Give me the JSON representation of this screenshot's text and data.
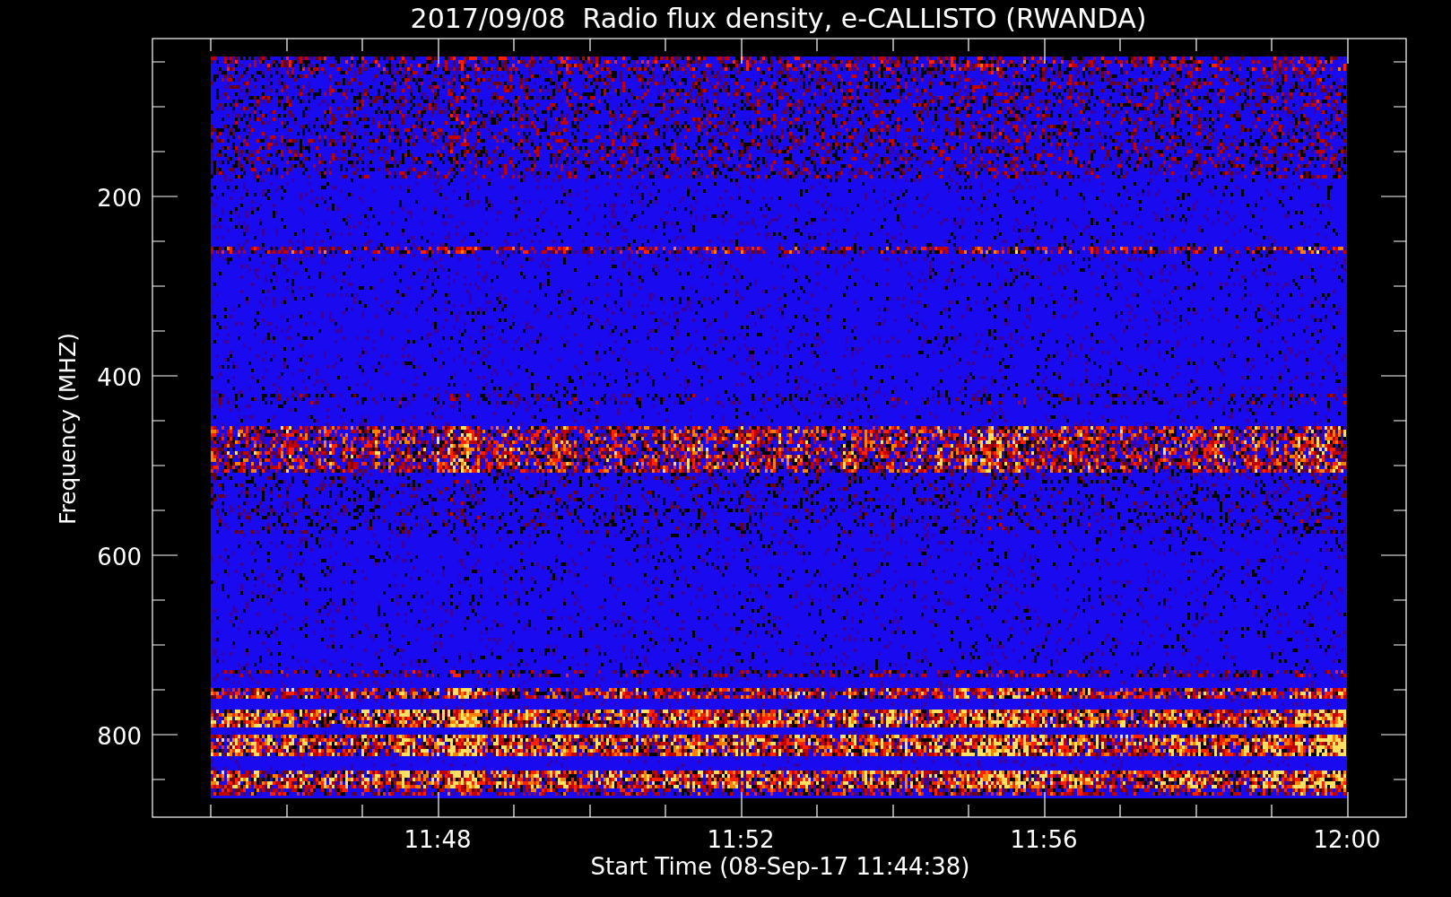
{
  "title": "2017/09/08  Radio flux density, e-CALLISTO (RWANDA)",
  "y_axis": {
    "label": "Frequency (MHZ)",
    "ticks": [
      "200",
      "400",
      "600",
      "800"
    ]
  },
  "x_axis": {
    "label": "Start Time (08-Sep-17 11:44:38)",
    "ticks": [
      "11:48",
      "11:52",
      "11:56",
      "12:00"
    ]
  }
}
